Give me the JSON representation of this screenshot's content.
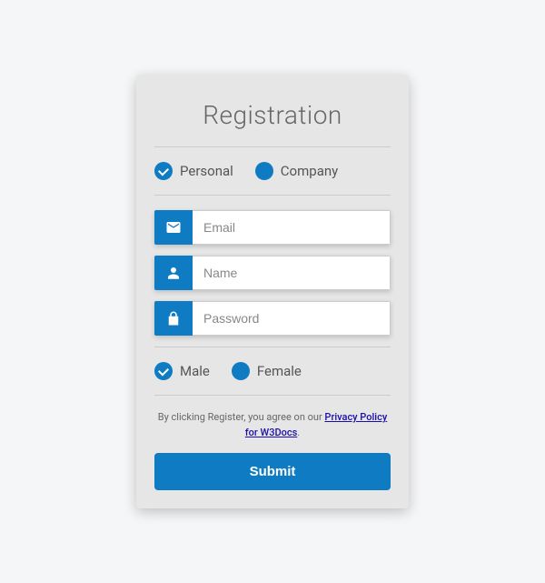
{
  "title": "Registration",
  "account_type": {
    "options": [
      {
        "label": "Personal",
        "checked": true
      },
      {
        "label": "Company",
        "checked": false
      }
    ]
  },
  "fields": {
    "email": {
      "placeholder": "Email",
      "value": ""
    },
    "name": {
      "placeholder": "Name",
      "value": ""
    },
    "password": {
      "placeholder": "Password",
      "value": ""
    }
  },
  "gender": {
    "options": [
      {
        "label": "Male",
        "checked": true
      },
      {
        "label": "Female",
        "checked": false
      }
    ]
  },
  "terms": {
    "prefix": "By clicking Register, you agree on our ",
    "link_text": "Privacy Policy for W3Docs",
    "suffix": "."
  },
  "submit_label": "Submit",
  "colors": {
    "accent": "#0f7bc2",
    "card_bg": "#e6e6e6",
    "page_bg": "#f5f6f7"
  }
}
